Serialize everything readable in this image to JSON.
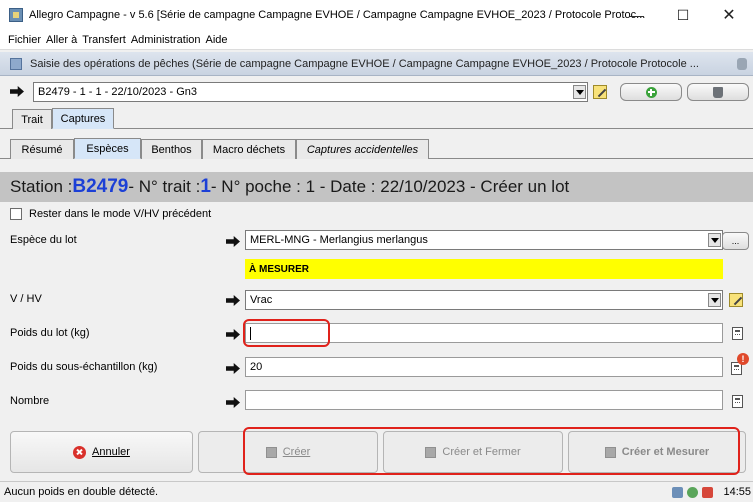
{
  "window": {
    "title": "Allegro Campagne - v 5.6 [Série de campagne Campagne EVHOE / Campagne Campagne EVHOE_2023 / Protocole Protoc...",
    "minimize": "—",
    "maximize": "☐",
    "close": "✕"
  },
  "menu": [
    "Fichier",
    "Aller à",
    "Transfert",
    "Administration",
    "Aide"
  ],
  "panel": {
    "title": "Saisie des opérations de pêches (Série de campagne Campagne EVHOE / Campagne Campagne EVHOE_2023 / Protocole Protocole ..."
  },
  "haul_selector": {
    "value": "B2479 - 1 - 1 - 22/10/2023 - Gn3"
  },
  "outer_tabs": [
    {
      "label": "Trait",
      "active": false
    },
    {
      "label": "Captures",
      "active": true
    }
  ],
  "inner_tabs": [
    {
      "label": "Résumé",
      "active": false
    },
    {
      "label": "Espèces",
      "active": true
    },
    {
      "label": "Benthos",
      "active": false
    },
    {
      "label": "Macro déchets",
      "active": false
    },
    {
      "label": "Captures accidentelles",
      "active": false
    }
  ],
  "station_banner": {
    "prefix": "Station : ",
    "station": "B2479",
    "trait_label": " - N° trait : ",
    "trait": "1",
    "rest": " - N° poche : 1 - Date : 22/10/2023 - Créer un lot"
  },
  "checkbox": {
    "label": "Rester dans le mode V/HV précédent",
    "checked": false
  },
  "form": {
    "species_label": "Espèce du lot",
    "species_value": "MERL-MNG - Merlangius merlangus",
    "dots_label": "...",
    "measure_label": "À MESURER",
    "vhv_label": "V / HV",
    "vhv_value": "Vrac",
    "weight_label": "Poids du lot (kg)",
    "weight_value": "",
    "subsample_label": "Poids du sous-échantillon (kg)",
    "subsample_value": "20",
    "count_label": "Nombre",
    "count_value": ""
  },
  "buttons": {
    "cancel": "Annuler",
    "create": "Créer",
    "create_close": "Créer et Fermer",
    "create_measure": "Créer et Mesurer"
  },
  "status": {
    "message": "Aucun poids en double détecté.",
    "time": "14:55"
  },
  "colors": {
    "station_highlight": "#1b3fd6",
    "measure_bar": "#ffff00",
    "annotation_red": "#e0221b"
  }
}
